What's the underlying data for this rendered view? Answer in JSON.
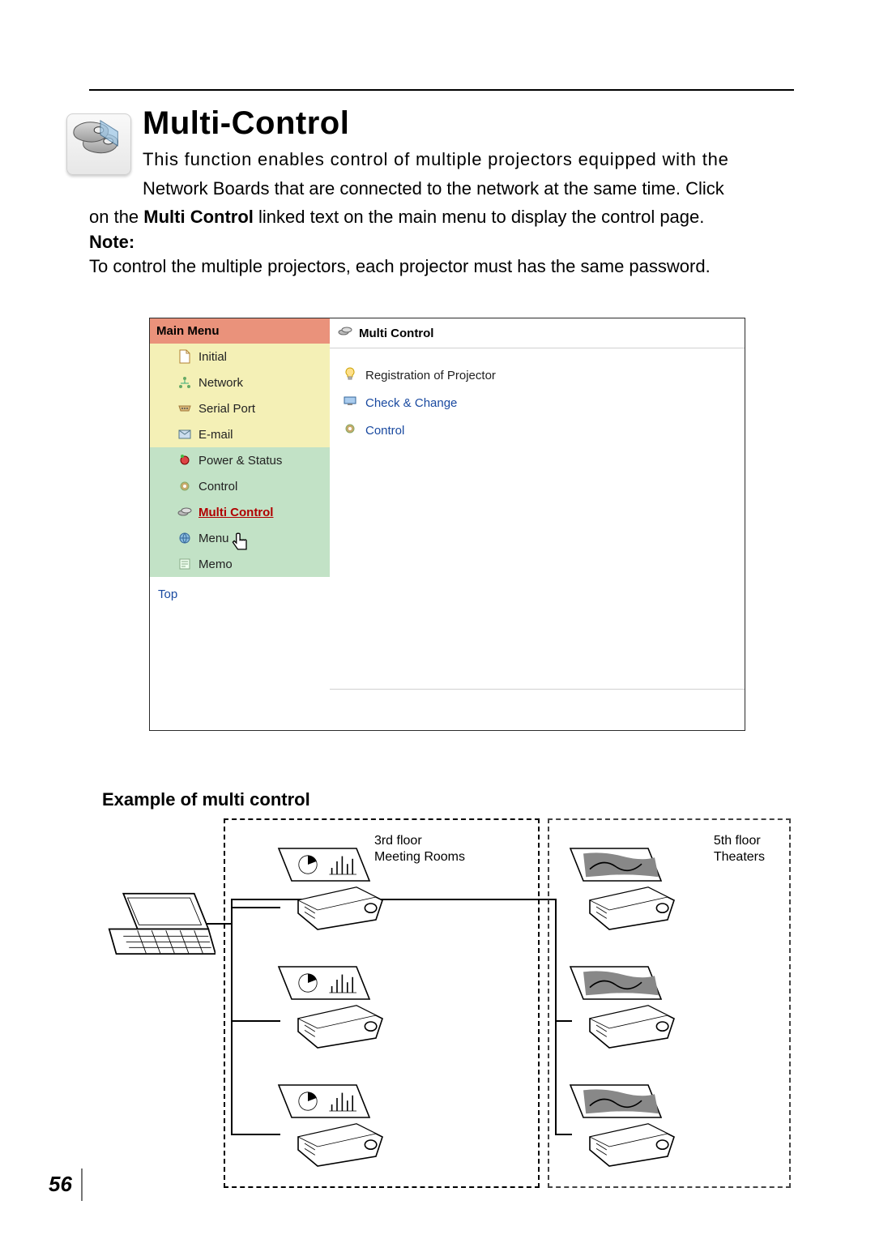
{
  "page_number": "56",
  "title": "Multi-Control",
  "intro_line1": "This function enables control of multiple projectors equipped with the",
  "intro_line2": "Network Boards that are connected to the network at the same time. Click",
  "body_before_bold": "on the ",
  "body_bold": "Multi Control",
  "body_after_bold": " linked text on the main menu to display the control page.",
  "note_label": "Note:",
  "note_text": "To control the multiple projectors, each projector must has the same password.",
  "main_menu": {
    "header": "Main Menu",
    "groups": {
      "setup": [
        {
          "label": "Initial",
          "icon": "page-icon"
        },
        {
          "label": "Network",
          "icon": "network-icon"
        },
        {
          "label": "Serial Port",
          "icon": "serial-icon"
        },
        {
          "label": "E-mail",
          "icon": "envelope-icon"
        }
      ],
      "control": [
        {
          "label": "Power & Status",
          "icon": "power-icon"
        },
        {
          "label": "Control",
          "icon": "gear-icon"
        },
        {
          "label": "Multi Control",
          "icon": "projectors-icon",
          "active": true
        },
        {
          "label": "Menu",
          "icon": "globe-icon"
        },
        {
          "label": "Memo",
          "icon": "memo-icon"
        }
      ]
    },
    "top_link": "Top"
  },
  "content_panel": {
    "header": "Multi Control",
    "options": [
      {
        "label": "Registration of Projector",
        "icon": "bulb-icon"
      },
      {
        "label": "Check & Change",
        "icon": "display-icon"
      },
      {
        "label": "Control",
        "icon": "gear-icon"
      }
    ]
  },
  "example": {
    "heading": "Example of multi control",
    "zone_a_line1": "3rd floor",
    "zone_a_line2": "Meeting Rooms",
    "zone_b_line1": "5th floor",
    "zone_b_line2": "Theaters"
  }
}
